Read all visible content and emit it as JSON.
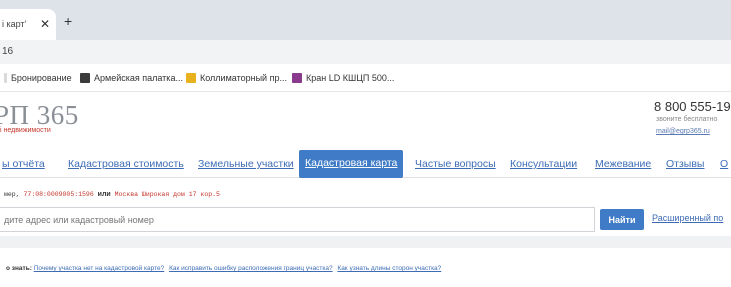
{
  "browser": {
    "tab_title": "і карт’",
    "tab_close": "✕",
    "new_tab": "+",
    "address_text": "16",
    "bookmarks": [
      {
        "label": "Бронирование",
        "icon": "bookmark-page-icon",
        "color": "#e0e0e0"
      },
      {
        "label": "Армейская палатка...",
        "icon": "army-tent-icon",
        "color": "#3b3b3b"
      },
      {
        "label": "Коллиматорный пр...",
        "icon": "collimator-icon",
        "color": "#e8b21e"
      },
      {
        "label": "Кран LD КШЦП 500...",
        "icon": "valve-icon",
        "color": "#8a3a8c"
      }
    ]
  },
  "header": {
    "logo": "РП 365",
    "logo_sub": "і недвижимости",
    "phone": "8 800 555-19",
    "phone_note": "звоните бесплатно",
    "email": "mail@egrp365.ru"
  },
  "nav": {
    "items": [
      {
        "label": "ы отчёта",
        "active": false
      },
      {
        "label": "Кадастровая стоимость",
        "active": false
      },
      {
        "label": "Земельные участки",
        "active": false
      },
      {
        "label": "Кадастровая карта",
        "active": true
      },
      {
        "label": "Частые вопросы",
        "active": false
      },
      {
        "label": "Консультации",
        "active": false
      },
      {
        "label": "Межевание",
        "active": false
      },
      {
        "label": "Отзывы",
        "active": false
      },
      {
        "label": "О",
        "active": false
      }
    ]
  },
  "search": {
    "example_prefix": "мер,",
    "example_number": "77:08:0009005:1596",
    "example_or": "или",
    "example_address": "Москва Широкая дом 17 кор.5",
    "placeholder": "дите адрес или кадастровый номер",
    "button_label": "Найти",
    "advanced_link": "Расширенный по"
  },
  "faq": {
    "label": "о знать:",
    "links": [
      "Почему участка нет на кадастровой карте?",
      "Как исправить ошибку расположения границ участка?",
      "Как узнать длины сторон участка?"
    ]
  },
  "colors": {
    "accent": "#3f7bc6",
    "link": "#3d6cb5",
    "logo_red": "#c4362b"
  }
}
